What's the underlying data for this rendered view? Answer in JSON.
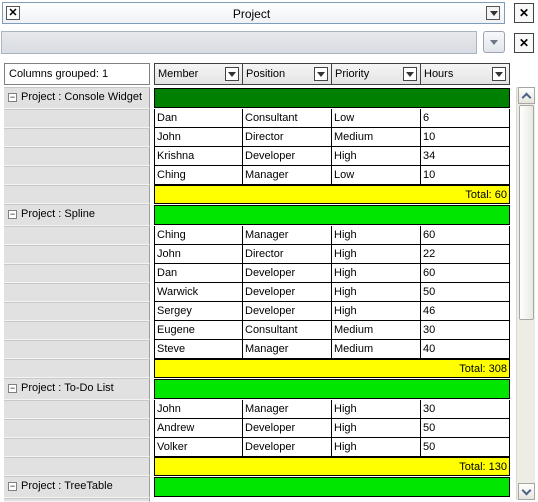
{
  "toolbar": {
    "title": "Project",
    "check_icon": "x-box-icon",
    "close_icon": "close-icon"
  },
  "grouped_label": "Columns grouped: 1",
  "columns": [
    "Member",
    "Position",
    "Priority",
    "Hours"
  ],
  "groups": [
    {
      "label": "Project : Console Widget",
      "rows": [
        [
          "Dan",
          "Consultant",
          "Low",
          "6"
        ],
        [
          "John",
          "Director",
          "Medium",
          "10"
        ],
        [
          "Krishna",
          "Developer",
          "High",
          "34"
        ],
        [
          "Ching",
          "Manager",
          "Low",
          "10"
        ]
      ],
      "total": "Total: 60",
      "color": "#008000"
    },
    {
      "label": "Project : Spline",
      "rows": [
        [
          "Ching",
          "Manager",
          "High",
          "60"
        ],
        [
          "John",
          "Director",
          "High",
          "22"
        ],
        [
          "Dan",
          "Developer",
          "High",
          "60"
        ],
        [
          "Warwick",
          "Developer",
          "High",
          "50"
        ],
        [
          "Sergey",
          "Developer",
          "High",
          "46"
        ],
        [
          "Eugene",
          "Consultant",
          "Medium",
          "30"
        ],
        [
          "Steve",
          "Manager",
          "Medium",
          "40"
        ]
      ],
      "total": "Total: 308",
      "color": "#00e600"
    },
    {
      "label": "Project : To-Do List",
      "rows": [
        [
          "John",
          "Manager",
          "High",
          "30"
        ],
        [
          "Andrew",
          "Developer",
          "High",
          "50"
        ],
        [
          "Volker",
          "Developer",
          "High",
          "50"
        ]
      ],
      "total": "Total: 130",
      "color": "#00e600"
    },
    {
      "label": "Project : TreeTable",
      "rows": [],
      "total": "",
      "color": "#00e600"
    }
  ]
}
